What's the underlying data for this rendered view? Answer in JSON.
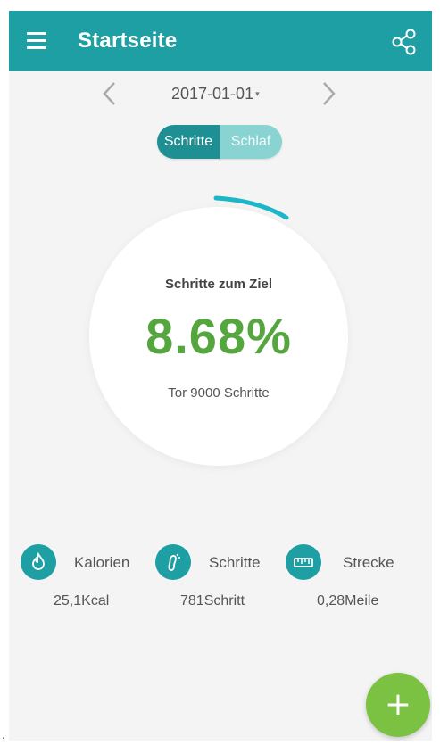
{
  "appbar": {
    "title": "Startseite",
    "menu_icon": "hamburger-menu-icon",
    "share_icon": "share-icon"
  },
  "date_nav": {
    "date": "2017-01-01",
    "caret": "▾",
    "prev_icon": "chevron-left-icon",
    "next_icon": "chevron-right-icon"
  },
  "toggle": {
    "steps_label": "Schritte",
    "sleep_label": "Schlaf",
    "selected": "Schritte"
  },
  "goal": {
    "label": "Schritte zum Ziel",
    "percent": "8.68%",
    "target": "Tor 9000 Schritte",
    "progress_fraction": 0.0868
  },
  "stats": [
    {
      "icon": "flame-icon",
      "label": "Kalorien",
      "value": "25,1Kcal"
    },
    {
      "icon": "footprint-icon",
      "label": "Schritte",
      "value": "781Schritt"
    },
    {
      "icon": "ruler-icon",
      "label": "Strecke",
      "value": "0,28Meile"
    }
  ],
  "fab": {
    "symbol": "+",
    "icon": "add-icon"
  },
  "footer_mark": ".",
  "colors": {
    "primary": "#1e9fa3",
    "primary_dark": "#1e8f93",
    "toggle_inactive": "#89d3d3",
    "progress_arc": "#1bb7c8",
    "percent_green": "#55a63f",
    "fab_green": "#7cc242",
    "background": "#f4f4f4"
  }
}
